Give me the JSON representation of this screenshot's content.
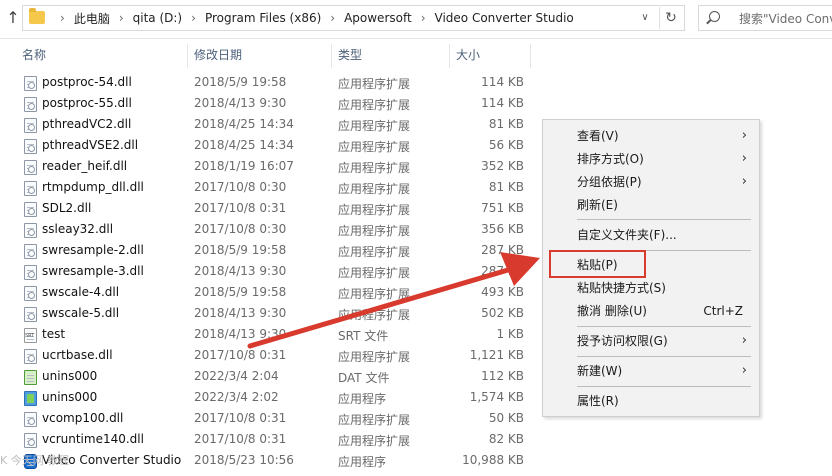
{
  "breadcrumb": [
    "此电脑",
    "qita (D:)",
    "Program Files (x86)",
    "Apowersoft",
    "Video Converter Studio"
  ],
  "search": {
    "placeholder": "搜索\"Video Conv"
  },
  "columns": {
    "name": "名称",
    "date": "修改日期",
    "type": "类型",
    "size": "大小"
  },
  "files": [
    {
      "name": "postproc-54.dll",
      "date": "2018/5/9 19:58",
      "type": "应用程序扩展",
      "size": "114 KB",
      "icon": "dll"
    },
    {
      "name": "postproc-55.dll",
      "date": "2018/4/13 9:30",
      "type": "应用程序扩展",
      "size": "114 KB",
      "icon": "dll"
    },
    {
      "name": "pthreadVC2.dll",
      "date": "2018/4/25 14:34",
      "type": "应用程序扩展",
      "size": "81 KB",
      "icon": "dll"
    },
    {
      "name": "pthreadVSE2.dll",
      "date": "2018/4/25 14:34",
      "type": "应用程序扩展",
      "size": "56 KB",
      "icon": "dll"
    },
    {
      "name": "reader_heif.dll",
      "date": "2018/1/19 16:07",
      "type": "应用程序扩展",
      "size": "352 KB",
      "icon": "dll"
    },
    {
      "name": "rtmpdump_dll.dll",
      "date": "2017/10/8 0:30",
      "type": "应用程序扩展",
      "size": "81 KB",
      "icon": "dll"
    },
    {
      "name": "SDL2.dll",
      "date": "2017/10/8 0:31",
      "type": "应用程序扩展",
      "size": "751 KB",
      "icon": "dll"
    },
    {
      "name": "ssleay32.dll",
      "date": "2017/10/8 0:30",
      "type": "应用程序扩展",
      "size": "356 KB",
      "icon": "dll"
    },
    {
      "name": "swresample-2.dll",
      "date": "2018/5/9 19:58",
      "type": "应用程序扩展",
      "size": "287 KB",
      "icon": "dll"
    },
    {
      "name": "swresample-3.dll",
      "date": "2018/4/13 9:30",
      "type": "应用程序扩展",
      "size": "287 KB",
      "icon": "dll"
    },
    {
      "name": "swscale-4.dll",
      "date": "2018/5/9 19:58",
      "type": "应用程序扩展",
      "size": "493 KB",
      "icon": "dll"
    },
    {
      "name": "swscale-5.dll",
      "date": "2018/4/13 9:30",
      "type": "应用程序扩展",
      "size": "502 KB",
      "icon": "dll"
    },
    {
      "name": "test",
      "date": "2018/4/13 9:30",
      "type": "SRT 文件",
      "size": "1 KB",
      "icon": "srt"
    },
    {
      "name": "ucrtbase.dll",
      "date": "2017/10/8 0:31",
      "type": "应用程序扩展",
      "size": "1,121 KB",
      "icon": "dll"
    },
    {
      "name": "unins000",
      "date": "2022/3/4 2:04",
      "type": "DAT 文件",
      "size": "112 KB",
      "icon": "dat"
    },
    {
      "name": "unins000",
      "date": "2022/3/4 2:02",
      "type": "应用程序",
      "size": "1,574 KB",
      "icon": "exe"
    },
    {
      "name": "vcomp100.dll",
      "date": "2017/10/8 0:31",
      "type": "应用程序扩展",
      "size": "50 KB",
      "icon": "dll"
    },
    {
      "name": "vcruntime140.dll",
      "date": "2017/10/8 0:31",
      "type": "应用程序扩展",
      "size": "82 KB",
      "icon": "dll"
    },
    {
      "name": "Video Converter Studio",
      "date": "2018/5/23 10:56",
      "type": "应用程序",
      "size": "10,988 KB",
      "icon": "vcs"
    }
  ],
  "context_menu": {
    "view": "查看(V)",
    "sort": "排序方式(O)",
    "group": "分组依据(P)",
    "refresh": "刷新(E)",
    "customize": "自定义文件夹(F)...",
    "paste": "粘贴(P)",
    "paste_shortcut": "粘贴快捷方式(S)",
    "undo_delete": "撤消 删除(U)",
    "undo_accel": "Ctrl+Z",
    "grant_access": "授予访问权限(G)",
    "new": "新建(W)",
    "properties": "属性(R)"
  },
  "watermark": "K 今天网 教程",
  "colors": {
    "highlight": "#d93a2e",
    "header_text": "#4c607a"
  }
}
